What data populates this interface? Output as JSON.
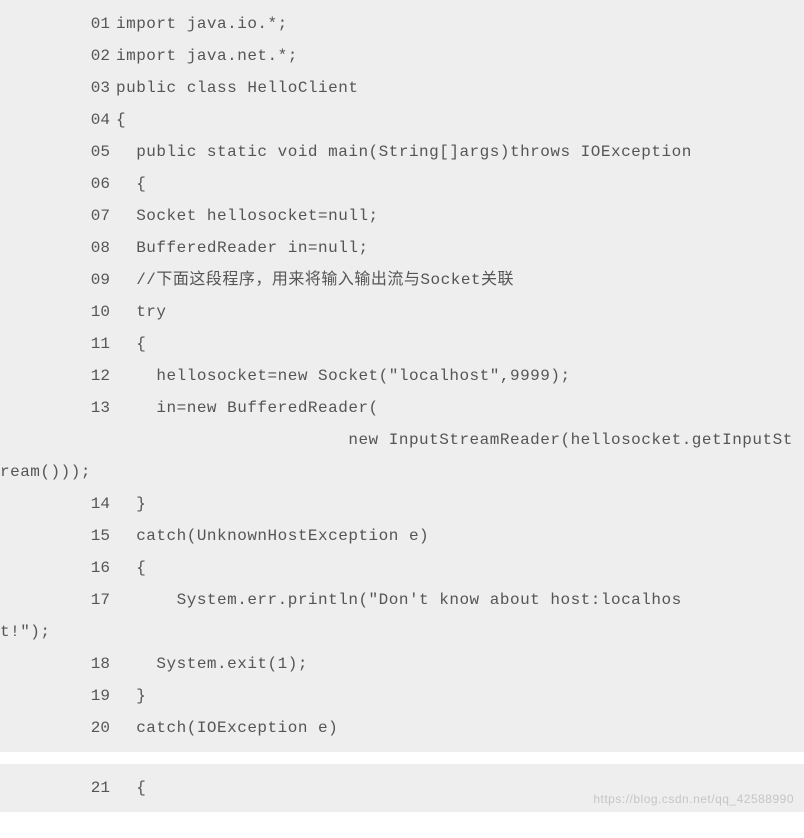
{
  "watermark": "https://blog.csdn.net/qq_42588990",
  "code_blocks": [
    {
      "lines": [
        {
          "no": "01",
          "text": "import java.io.*;",
          "indent": 0,
          "wrap": false
        },
        {
          "no": "02",
          "text": "import java.net.*;",
          "indent": 0,
          "wrap": false
        },
        {
          "no": "03",
          "text": "public class HelloClient",
          "indent": 0,
          "wrap": false
        },
        {
          "no": "04",
          "text": "{",
          "indent": 0,
          "wrap": false
        },
        {
          "no": "05",
          "text": "  public static void main(String[]args)throws IOException",
          "indent": 0,
          "wrap": false
        },
        {
          "no": "06",
          "text": "  {",
          "indent": 0,
          "wrap": false
        },
        {
          "no": "07",
          "text": "  Socket hellosocket=null;",
          "indent": 0,
          "wrap": false
        },
        {
          "no": "08",
          "text": "  BufferedReader in=null;",
          "indent": 0,
          "wrap": false
        },
        {
          "no": "09",
          "text": "  //下面这段程序，用来将输入输出流与Socket关联",
          "indent": 0,
          "wrap": false
        },
        {
          "no": "10",
          "text": "  try",
          "indent": 0,
          "wrap": false
        },
        {
          "no": "11",
          "text": "  {",
          "indent": 0,
          "wrap": false
        },
        {
          "no": "12",
          "text": "    hellosocket=new Socket(″localhost″,9999);",
          "indent": 0,
          "wrap": false
        },
        {
          "no": "13",
          "text": "    in=new BufferedReader(",
          "indent": 0,
          "wrap": false
        },
        {
          "no": "",
          "text": "                       new InputStreamReader(hellosocket.getInputSt",
          "indent": 0,
          "wrap": true
        },
        {
          "no": "",
          "text": "ream()));",
          "indent": -1,
          "wrap": true
        },
        {
          "no": "14",
          "text": "  }",
          "indent": 0,
          "wrap": false
        },
        {
          "no": "15",
          "text": "  catch(UnknownHostException e)",
          "indent": 0,
          "wrap": false
        },
        {
          "no": "16",
          "text": "  {",
          "indent": 0,
          "wrap": false
        },
        {
          "no": "  17",
          "text": "      System.err.println(″Don't know about host:localhos",
          "indent": 0,
          "wrap": false
        },
        {
          "no": "",
          "text": "t!″);",
          "indent": -1,
          "wrap": true
        },
        {
          "no": "18",
          "text": "    System.exit(1);",
          "indent": 0,
          "wrap": false
        },
        {
          "no": "19",
          "text": "  }",
          "indent": 0,
          "wrap": false
        },
        {
          "no": "20",
          "text": "  catch(IOException e)",
          "indent": 0,
          "wrap": false
        }
      ]
    },
    {
      "lines": [
        {
          "no": "21",
          "text": "  {",
          "indent": 0,
          "wrap": false
        }
      ]
    }
  ]
}
